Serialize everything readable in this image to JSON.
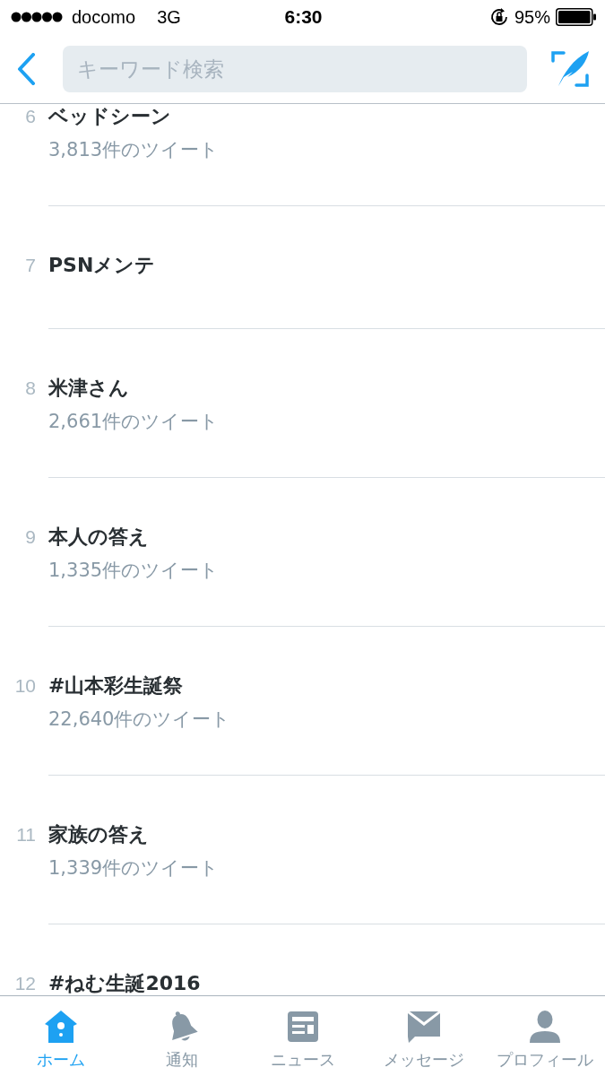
{
  "status_bar": {
    "carrier": "docomo",
    "network": "3G",
    "time": "6:30",
    "battery": "95%"
  },
  "search": {
    "placeholder": "キーワード検索"
  },
  "trends": [
    {
      "rank": "6",
      "name": "ベッドシーン",
      "count": "3,813件のツイート"
    },
    {
      "rank": "7",
      "name": "PSNメンテ"
    },
    {
      "rank": "8",
      "name": "米津さん",
      "count": "2,661件のツイート"
    },
    {
      "rank": "9",
      "name": "本人の答え",
      "count": "1,335件のツイート"
    },
    {
      "rank": "10",
      "name": "#山本彩生誕祭",
      "count": "22,640件のツイート"
    },
    {
      "rank": "11",
      "name": "家族の答え",
      "count": "1,339件のツイート"
    },
    {
      "rank": "12",
      "name": "#ねむ生誕2016"
    }
  ],
  "tab_bar": [
    {
      "kind": "home",
      "label": "ホーム",
      "selected": true
    },
    {
      "kind": "notifications",
      "label": "通知",
      "selected": false
    },
    {
      "kind": "news",
      "label": "ニュース",
      "selected": false
    },
    {
      "kind": "messages",
      "label": "メッセージ",
      "selected": false
    },
    {
      "kind": "profile",
      "label": "プロフィール",
      "selected": false
    }
  ]
}
